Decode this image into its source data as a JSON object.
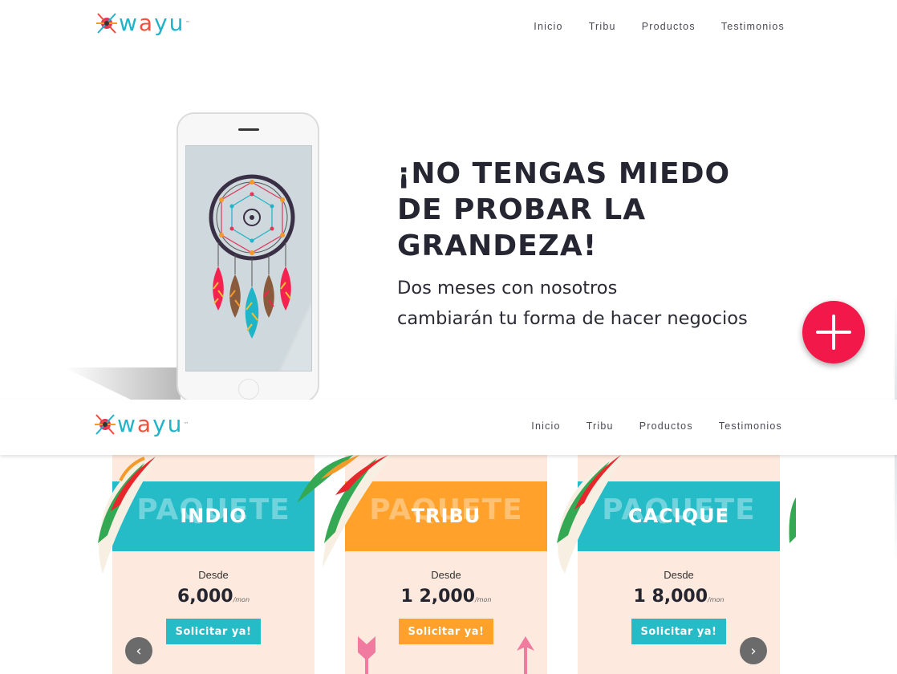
{
  "brand": {
    "logo_text": "wayu",
    "logo_tm": "™"
  },
  "nav": {
    "items": [
      {
        "label": "Inicio"
      },
      {
        "label": "Tribu"
      },
      {
        "label": "Productos"
      },
      {
        "label": "Testimonios"
      }
    ]
  },
  "hero": {
    "title_line1": "¡NO TENGAS MIEDO",
    "title_line2": "DE PROBAR LA",
    "title_line3": "GRANDEZA!",
    "subtitle_line1": "Dos meses con nosotros",
    "subtitle_line2": "cambiarán tu forma de hacer negocios"
  },
  "fab": {
    "icon": "plus-icon",
    "color": "#f2184a"
  },
  "pricing": {
    "cards": [
      {
        "ghost": "PAQUETE",
        "name": "INDIO",
        "desde": "Desde",
        "price": "6,000",
        "per": "/mon",
        "cta": "Solicitar ya!",
        "color": "#25bcc8"
      },
      {
        "ghost": "PAQUETE",
        "name": "TRIBU",
        "desde": "Desde",
        "price": "1 2,000",
        "per": "/mon",
        "cta": "Solicitar ya!",
        "color": "#ffa12a"
      },
      {
        "ghost": "PAQUETE",
        "name": "CACIQUE",
        "desde": "Desde",
        "price": "1 8,000",
        "per": "/mon",
        "cta": "Solicitar ya!",
        "color": "#25bcc8"
      }
    ],
    "prev_icon": "chevron-left-icon",
    "next_icon": "chevron-right-icon"
  }
}
